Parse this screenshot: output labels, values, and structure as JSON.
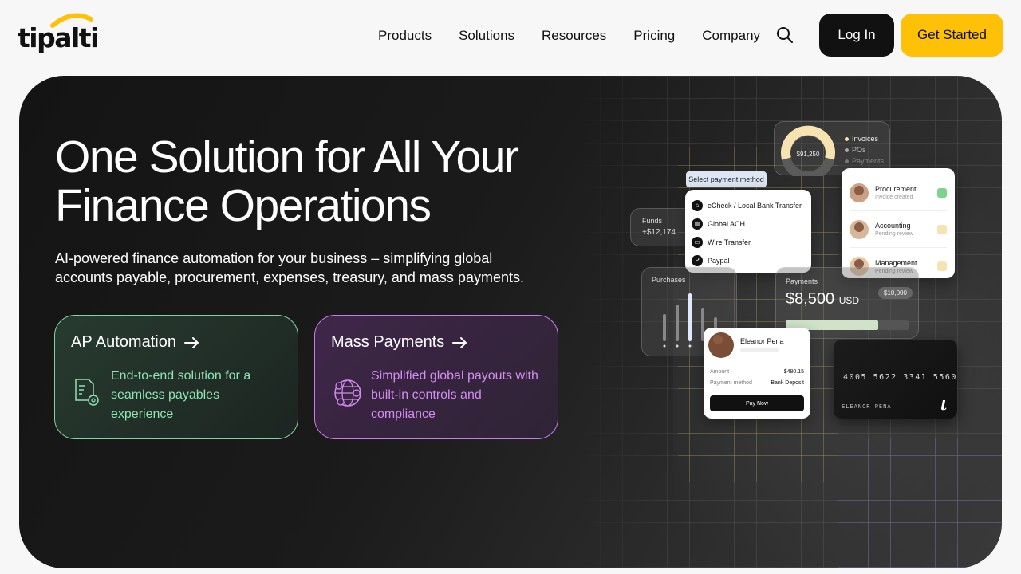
{
  "brand": {
    "logo_text": "tipalti",
    "accent": "#ffc107"
  },
  "nav": {
    "items": [
      "Products",
      "Solutions",
      "Resources",
      "Pricing",
      "Company"
    ],
    "search_icon": "search-icon",
    "login_label": "Log In",
    "get_started_label": "Get Started"
  },
  "hero": {
    "title_line1": "One Solution for All Your",
    "title_line2": "Finance Operations",
    "subtitle": "AI-powered finance automation for your business – simplifying global accounts payable, procurement, expenses, treasury, and mass payments.",
    "cards": [
      {
        "title": "AP Automation",
        "description": "End-to-end solution for a seamless payables experience",
        "icon": "invoice-gear-icon",
        "color": "#8fe2b1"
      },
      {
        "title": "Mass Payments",
        "description": "Simplified global payouts with built-in controls and compliance",
        "icon": "globe-currency-icon",
        "color": "#d48cf0"
      }
    ]
  },
  "dashboard": {
    "donut": {
      "amount": "$91,250",
      "legend": [
        "Invoices",
        "POs",
        "Payments"
      ]
    },
    "payment_method": {
      "tag": "Select payment method",
      "options": [
        "eCheck / Local Bank Transfer",
        "Global ACH",
        "Wire Transfer",
        "Paypal"
      ]
    },
    "funds": {
      "label": "Funds",
      "value": "+$12,174"
    },
    "approvals": [
      {
        "role": "Procurement",
        "status": "Invoice created"
      },
      {
        "role": "Accounting",
        "status": "Pending review"
      },
      {
        "role": "Management",
        "status": "Pending review"
      }
    ],
    "purchases": {
      "label": "Purchases"
    },
    "payments": {
      "label": "Payments",
      "amount": "$8,500",
      "currency": "USD",
      "limit": "$10,000",
      "progress": 0.75
    },
    "payee": {
      "name": "Eleanor Pena",
      "amount_label": "Amount",
      "amount": "$480.15",
      "method_label": "Payment method",
      "method": "Bank Deposit",
      "button": "Pay Now"
    },
    "card": {
      "number": "4005 5622 3341 5560",
      "holder": "ELEANOR PENA",
      "logo": "t"
    }
  }
}
